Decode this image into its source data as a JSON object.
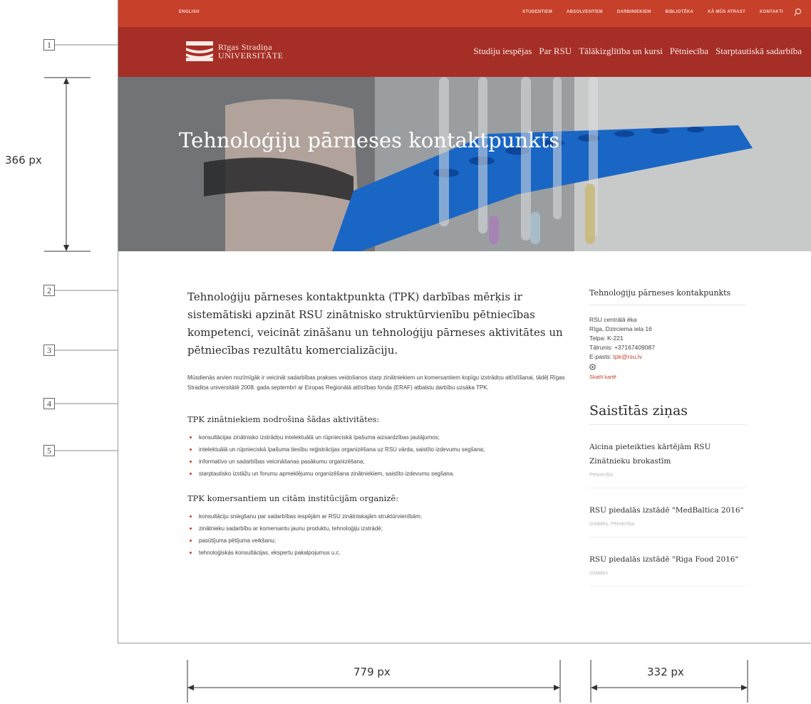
{
  "annotations": {
    "callouts": [
      "1",
      "2",
      "3",
      "4",
      "5"
    ],
    "hero_height": "366 px",
    "content_width": "779 px",
    "sidebar_width": "332 px"
  },
  "utility_bar": {
    "language": "ENGLISH",
    "links": [
      "STUDENTIEM",
      "ABSOLVENTIEM",
      "DARBINIEKIEM",
      "BIBLIOTĒKA",
      "KĀ MŪS ATRAST",
      "KONTAKTI"
    ],
    "search_icon": "search-icon",
    "color": "#c7402a"
  },
  "main_nav": {
    "logo_line1": "Rīgas Stradiņa",
    "logo_line2": "UNIVERSITĀTE",
    "items": [
      "Studiju iespējas",
      "Par RSU",
      "Tālākizglītība un kursi",
      "Pētniecība",
      "Starptautiskā sadarbība"
    ],
    "color": "#a52e26"
  },
  "hero": {
    "title": "Tehnoloģiju pārneses kontaktpunkts"
  },
  "content": {
    "lead": "Tehnoloģiju pārneses kontaktpunkta (TPK) darbības mērķis ir sistemātiski apzināt RSU zinātnisko struktūrvienību pētniecības kompetenci, veicināt zināšanu un tehnoloģiju pārneses aktivitātes un pētniecības rezultātu komercializāciju.",
    "body": "Mūsdienās arvien nozīmīgāk ir veicināt sadarbības prakses veidošanos starp zinātniekiem un komersantiem kopīgu izstrādņu attīstīšanai, tādēļ Rīgas Stradiņa universitātē 2008. gada septembrī ar Eiropas Reģionālā attīstības fonda (ERAF) atbalstu darbību uzsāka TPK.",
    "section1_heading": "TPK zinātniekiem nodrošina šādas aktivitātes:",
    "section1_items": [
      "konsultācijas zinātnisko izstrādņu intelektuālā un rūpnieciskā īpašuma aizsardzības jautājumos;",
      "intelektuālā un rūpnieciskā īpašuma tiesību reģistrācijas organizēšana uz RSU vārda, saistīto izdevumu segšana;",
      "informatīvo un sadarbības veicināšanas pasākumu organizēšana;",
      "starptautisko izstāžu un forumu apmeklējumu organizēšana zinātniekiem, saistīto izdevumu segšana."
    ],
    "section2_heading": "TPK komersantiem un citām institūcijām organizē:",
    "section2_items": [
      "konsultāciju sniegšanu par sadarbības iespējām ar RSU zinātniskajām struktūrvienībām;",
      "zinātnieku sadarbību ar komersantu jaunu produktu, tehnoloģiju izstrādē;",
      "pasūtījuma pētījuma veikšanu;",
      "tehnoloģiskās konsultācijas, ekspertu pakalpojumus u.c."
    ]
  },
  "sidebar": {
    "heading": "Tehnoloģiju pārneses kontakpunkts",
    "contact_lines": [
      "RSU centrālā ēka",
      "Rīga, Dzirciema iela 16",
      "Telpa: K-221",
      "Tālrunis: +37167409087"
    ],
    "email_label": "E-pasts: ",
    "email": "tpk@rsu.lv",
    "map_icon": "map-pin-icon",
    "map_link": "Skatīt kartē",
    "news_title": "Saistītās ziņas",
    "news": [
      {
        "title": "Aicina pieteikties kārtējām RSU Zinātnieku brokastīm",
        "category": "Pētniecība"
      },
      {
        "title": "RSU piedalās izstādē \"MedBaltica 2016\"",
        "category": "Izstādes, Pētniecība"
      },
      {
        "title": "RSU piedalās izstādē \"Riga Food 2016\"",
        "category": "Izstādes"
      }
    ]
  },
  "accent_color": "#c7402a"
}
